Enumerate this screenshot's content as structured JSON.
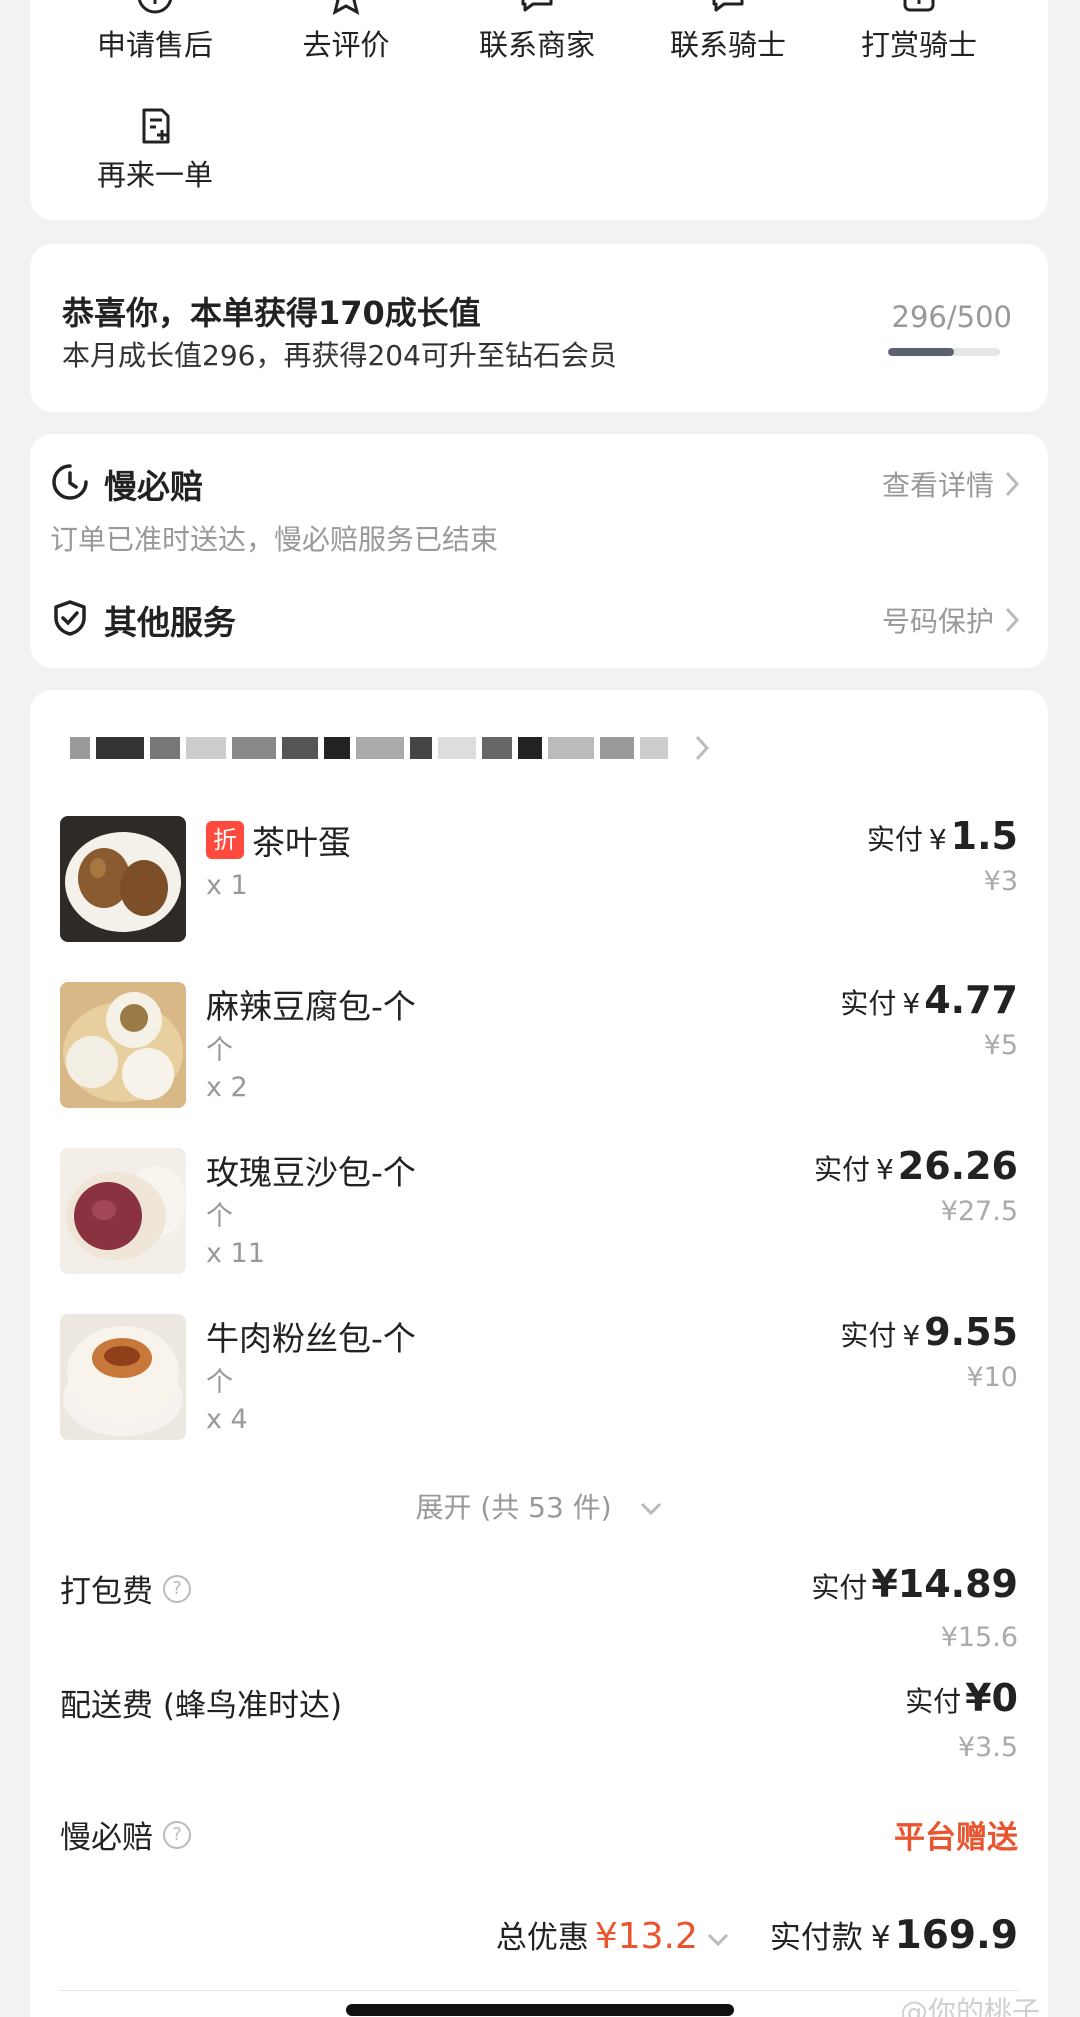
{
  "actions": [
    {
      "label": "申请售后",
      "icon": "plus-circle-icon"
    },
    {
      "label": "去评价",
      "icon": "star-icon"
    },
    {
      "label": "联系商家",
      "icon": "chat-bubble-icon"
    },
    {
      "label": "联系骑士",
      "icon": "chat-bubble-icon"
    },
    {
      "label": "打赏骑士",
      "icon": "gift-icon"
    },
    {
      "label": "再来一单",
      "icon": "reorder-icon"
    }
  ],
  "growth": {
    "title": "恭喜你，本单获得170成长值",
    "subtitle": "本月成长值296，再获得204可升至钻石会员",
    "progress_text": "296/500",
    "progress_value": 296,
    "progress_max": 500
  },
  "service": {
    "slow_title": "慢必赔",
    "slow_link": "查看详情",
    "slow_sub": "订单已准时送达，慢必赔服务已结束",
    "other_title": "其他服务",
    "other_link": "号码保护"
  },
  "items": [
    {
      "name": "茶叶蛋",
      "badge": "折",
      "unit": "",
      "qty": "x 1",
      "pay_label": "实付",
      "yen": "¥",
      "pay": "1.5",
      "orig": "¥3"
    },
    {
      "name": "麻辣豆腐包-个",
      "badge": "",
      "unit": "个",
      "qty": "x 2",
      "pay_label": "实付",
      "yen": "¥",
      "pay": "4.77",
      "orig": "¥5"
    },
    {
      "name": "玫瑰豆沙包-个",
      "badge": "",
      "unit": "个",
      "qty": "x 11",
      "pay_label": "实付",
      "yen": "¥",
      "pay": "26.26",
      "orig": "¥27.5"
    },
    {
      "name": "牛肉粉丝包-个",
      "badge": "",
      "unit": "个",
      "qty": "x 4",
      "pay_label": "实付",
      "yen": "¥",
      "pay": "9.55",
      "orig": "¥10"
    }
  ],
  "expand_label": "展开 (共 53 件)",
  "fees": {
    "packing_label": "打包费",
    "packing_pay_label": "实付",
    "packing_pay": "¥14.89",
    "packing_orig": "¥15.6",
    "delivery_label": "配送费 (蜂鸟准时达)",
    "delivery_pay_label": "实付",
    "delivery_pay": "¥0",
    "delivery_orig": "¥3.5",
    "slow_label": "慢必赔",
    "slow_value": "平台赠送"
  },
  "totals": {
    "discount_label": "总优惠",
    "discount": "¥13.2",
    "paid_label": "实付款",
    "paid_yen": "¥",
    "paid": "169.9"
  },
  "watermark": "@你的桃子",
  "colors": {
    "accent_red": "#e8552f",
    "badge_red": "#ff4a3d",
    "progress_fill": "#5c6270"
  }
}
